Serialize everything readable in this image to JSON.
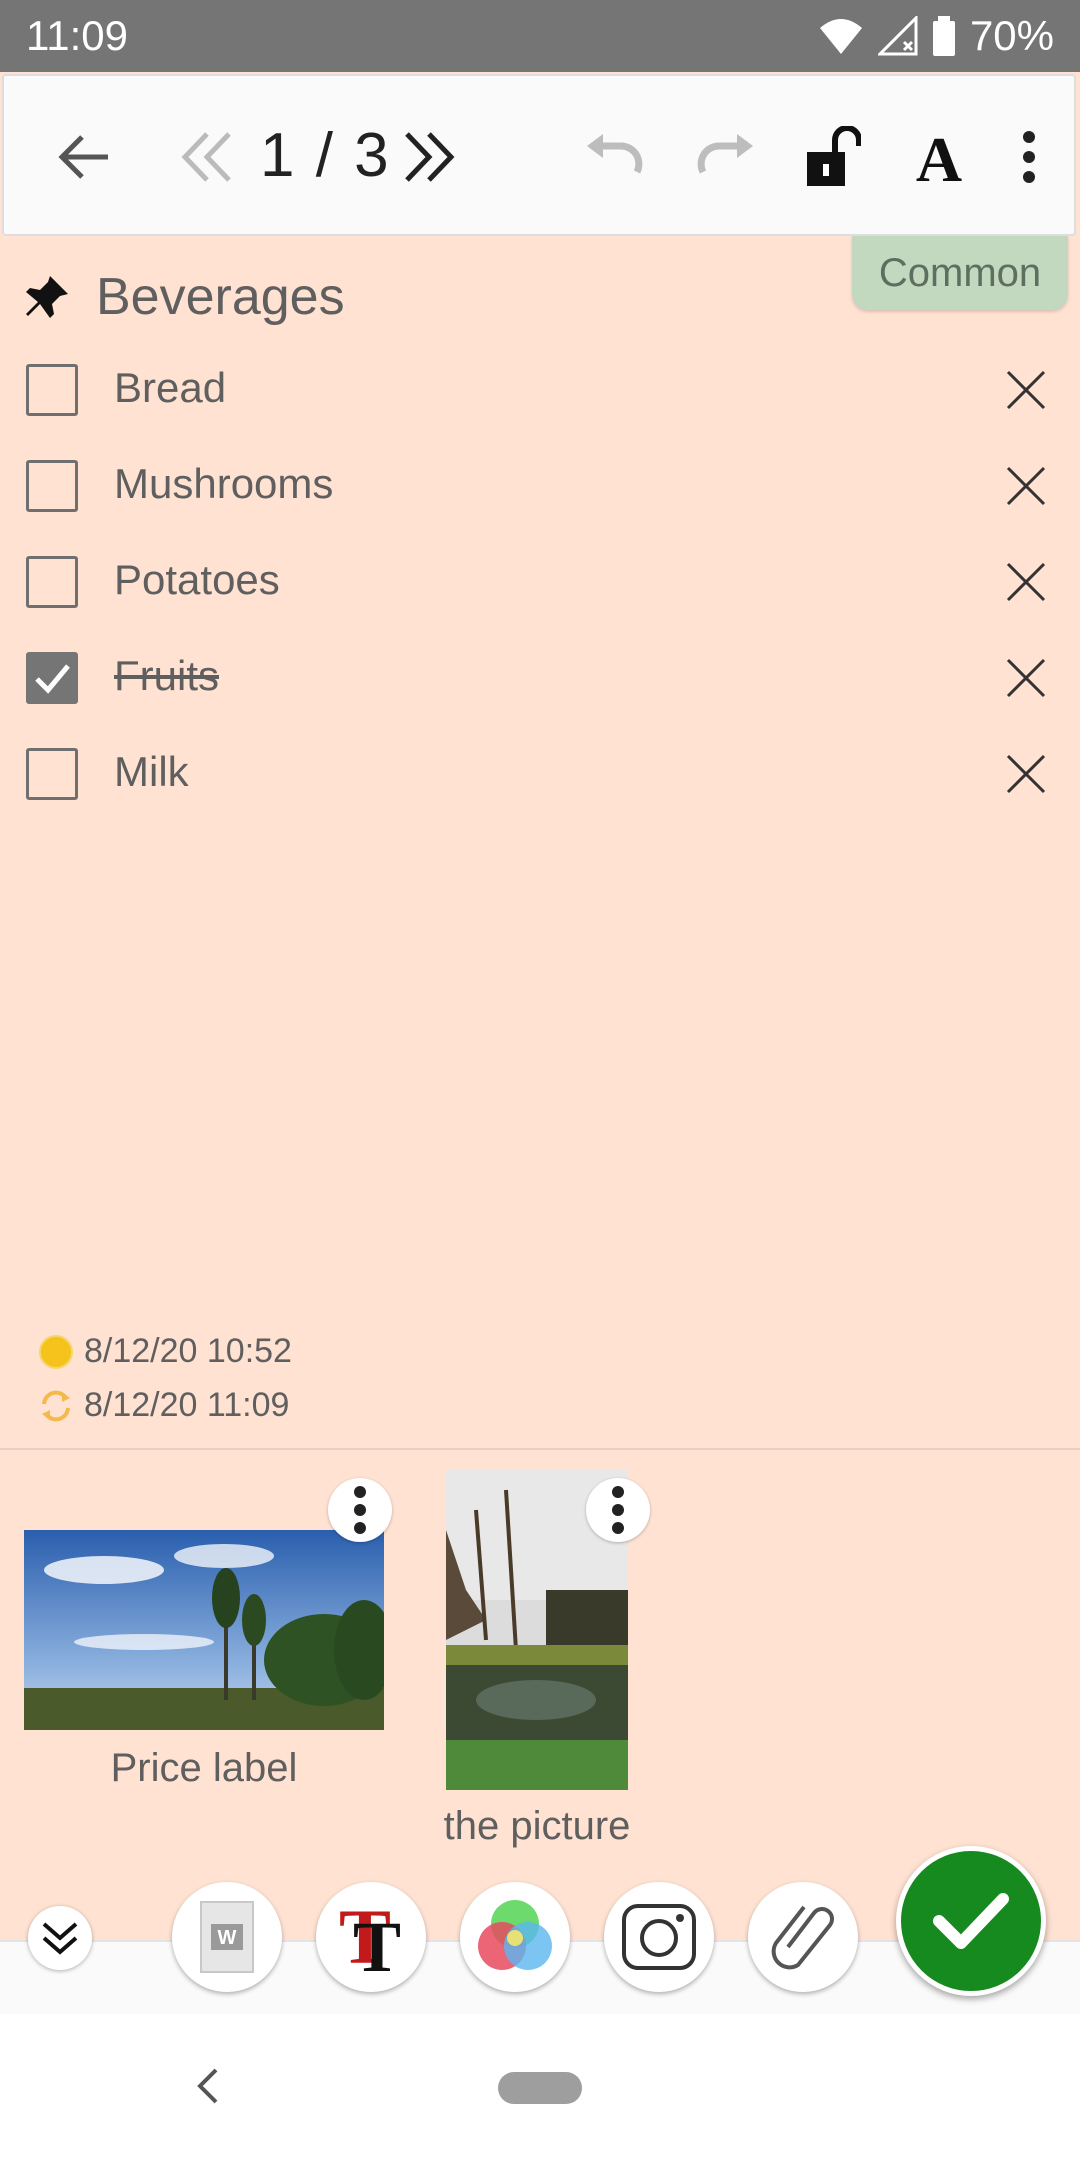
{
  "status_bar": {
    "time": "11:09",
    "battery": "70%"
  },
  "toolbar": {
    "page_counter": "1 / 3",
    "icons": [
      "back-arrow-icon",
      "prev-page-icon",
      "next-page-icon",
      "undo-icon",
      "redo-icon",
      "unlock-icon",
      "font-icon",
      "more-vert-icon"
    ]
  },
  "note": {
    "category": "Common",
    "title": "Beverages",
    "items": [
      {
        "label": "Bread",
        "checked": false
      },
      {
        "label": "Mushrooms",
        "checked": false
      },
      {
        "label": "Potatoes",
        "checked": false
      },
      {
        "label": "Fruits",
        "checked": true
      },
      {
        "label": "Milk",
        "checked": false
      }
    ],
    "created": "8/12/20 10:52",
    "modified": "8/12/20 11:09"
  },
  "attachments": [
    {
      "caption": "Price label"
    },
    {
      "caption": "the picture"
    }
  ],
  "bottom_tools": [
    "collapse-icon",
    "word-doc-icon",
    "text-style-icon",
    "color-palette-icon",
    "camera-icon",
    "paperclip-icon",
    "save-check-icon"
  ],
  "colors": {
    "note_bg": "#ffe2d2",
    "category_bg": "#c2d8bf",
    "save_green": "#178a1f"
  }
}
